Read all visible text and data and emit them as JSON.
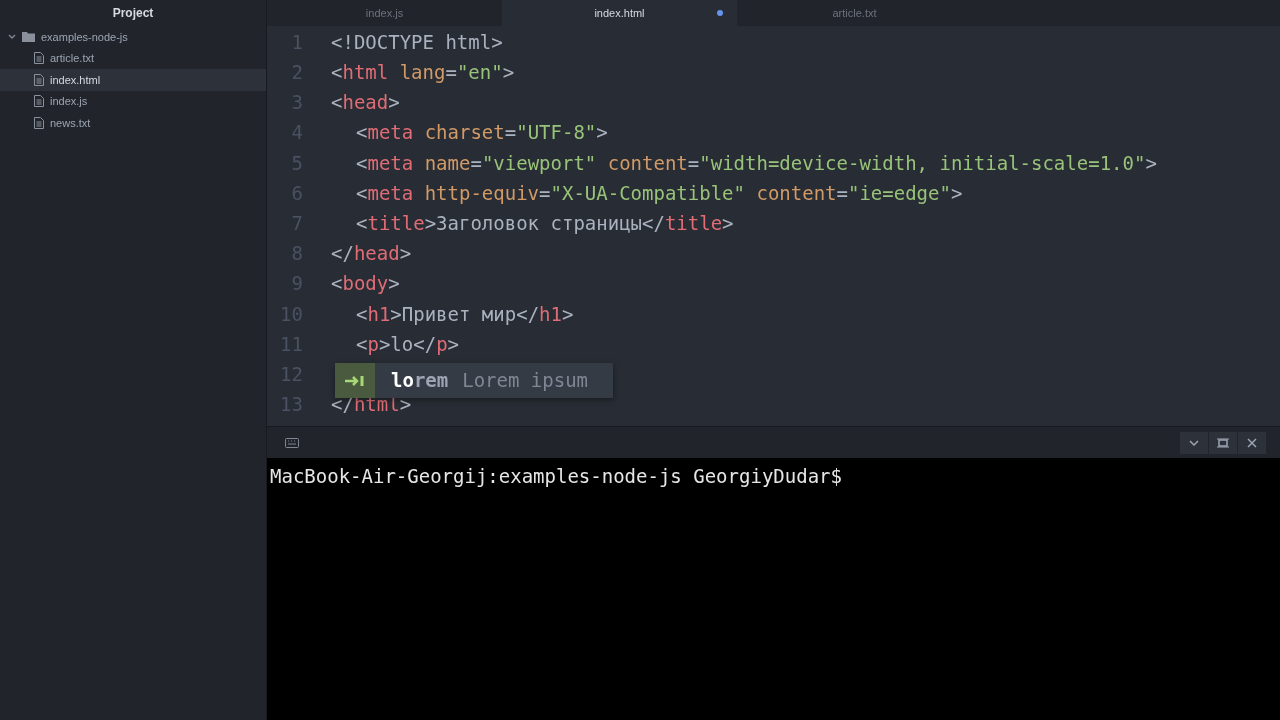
{
  "sidebar": {
    "title": "Project",
    "tree": [
      {
        "name": "examples-node-js",
        "kind": "folder",
        "expanded": true,
        "selected": false,
        "children": [
          {
            "name": "article.txt",
            "kind": "file",
            "selected": false
          },
          {
            "name": "index.html",
            "kind": "file",
            "selected": true
          },
          {
            "name": "index.js",
            "kind": "file",
            "selected": false
          },
          {
            "name": "news.txt",
            "kind": "file",
            "selected": false
          }
        ]
      }
    ]
  },
  "tabs": [
    {
      "label": "index.js",
      "selected": false,
      "modified": false
    },
    {
      "label": "index.html",
      "selected": true,
      "modified": true
    },
    {
      "label": "article.txt",
      "selected": false,
      "modified": false
    }
  ],
  "editor": {
    "lines": [
      {
        "number": "1",
        "indent": false,
        "text": "<!DOCTYPE html>"
      },
      {
        "number": "2",
        "indent": false,
        "text": "<html lang=\"en\">"
      },
      {
        "number": "3",
        "indent": false,
        "text": "<head>"
      },
      {
        "number": "4",
        "indent": true,
        "text": "<meta charset=\"UTF-8\">"
      },
      {
        "number": "5",
        "indent": true,
        "text": "<meta name=\"viewport\" content=\"width=device-width, initial-scale=1.0\">"
      },
      {
        "number": "6",
        "indent": true,
        "text": "<meta http-equiv=\"X-UA-Compatible\" content=\"ie=edge\">"
      },
      {
        "number": "7",
        "indent": true,
        "text": "<title>Заголовок страницы</title>"
      },
      {
        "number": "8",
        "indent": false,
        "text": "</head>"
      },
      {
        "number": "9",
        "indent": false,
        "text": "<body>"
      },
      {
        "number": "10",
        "indent": true,
        "text": "<h1>Привет мир</h1>"
      },
      {
        "number": "11",
        "indent": true,
        "text": "<p>lo</p>"
      },
      {
        "number": "12"
      },
      {
        "number": "13",
        "indent": false,
        "text": "</html>"
      }
    ],
    "autocomplete": {
      "text": "**lo**rem",
      "description": "Lorem ipsum"
    }
  },
  "terminal": {
    "prompt": "MacBook-Air-Georgij:examples-node-js GeorgiyDudar$"
  }
}
